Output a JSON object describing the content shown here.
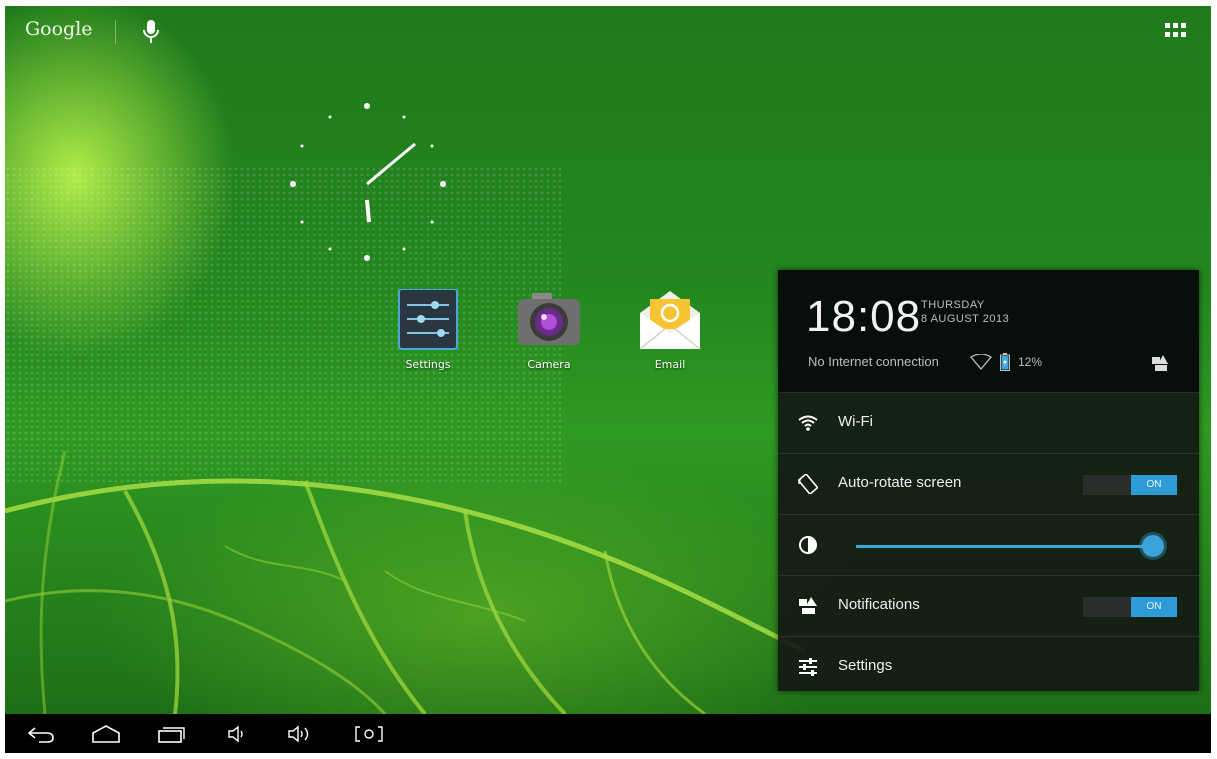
{
  "topbar": {
    "search_label": "Google"
  },
  "apps": [
    {
      "label": "Settings"
    },
    {
      "label": "Camera"
    },
    {
      "label": "Email"
    }
  ],
  "panel": {
    "time": "18:08",
    "day": "THURSDAY",
    "date": "8 AUGUST 2013",
    "network_status": "No Internet connection",
    "battery": "12%",
    "wifi_label": "Wi-Fi",
    "autorotate_label": "Auto-rotate screen",
    "autorotate_state": "ON",
    "brightness_level": 0.97,
    "notifications_label": "Notifications",
    "notifications_state": "ON",
    "settings_label": "Settings"
  },
  "colors": {
    "accent": "#2e9ad6",
    "panel_bg": "#121812",
    "wallpaper": "#23871f"
  }
}
